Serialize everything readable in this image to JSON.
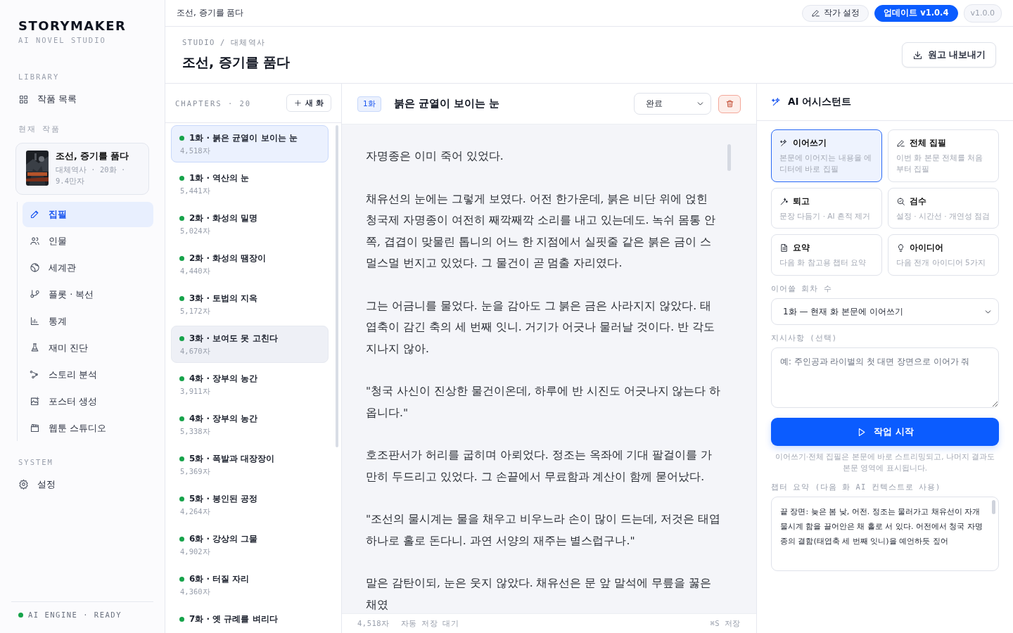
{
  "brand": {
    "name": "STORYMAKER",
    "tagline": "AI NOVEL STUDIO"
  },
  "sidebar": {
    "library_label": "LIBRARY",
    "library_item": {
      "label": "작품 목록"
    },
    "current_label": "현재 작품",
    "current_work": {
      "title": "조선, 증기를 품다",
      "meta": "대체역사 · 20화 · 9.4만자"
    },
    "items": [
      {
        "label": "집필",
        "selected": true
      },
      {
        "label": "인물",
        "selected": false
      },
      {
        "label": "세계관",
        "selected": false
      },
      {
        "label": "플롯 · 복선",
        "selected": false
      },
      {
        "label": "통계",
        "selected": false
      },
      {
        "label": "재미 진단",
        "selected": false
      },
      {
        "label": "스토리 분석",
        "selected": false
      },
      {
        "label": "포스터 생성",
        "selected": false
      },
      {
        "label": "웹툰 스튜디오",
        "selected": false
      }
    ],
    "system_label": "SYSTEM",
    "system_item": {
      "label": "설정"
    },
    "engine_status": {
      "text": "AI ENGINE · READY",
      "color": "#16a34a"
    }
  },
  "topbar": {
    "title": "조선, 증기를 품다",
    "author_button": "작가 설정",
    "update_button": "업데이트 v1.0.4",
    "version": "v1.0.0"
  },
  "header": {
    "breadcrumb": [
      "STUDIO",
      "/",
      "대체역사"
    ],
    "title": "조선, 증기를 품다",
    "export_button": "원고 내보내기"
  },
  "chapters": {
    "label": "CHAPTERS · 20",
    "new_button": "새 화",
    "items": [
      {
        "title": "1화 · 붉은 균열이 보이는 눈",
        "count": "4,518자",
        "selected": true,
        "hovered": false,
        "color": "#16a34a"
      },
      {
        "title": "1화 · 역산의 눈",
        "count": "5,441자",
        "selected": false,
        "hovered": false,
        "color": "#16a34a"
      },
      {
        "title": "2화 · 화성의 밀명",
        "count": "5,024자",
        "selected": false,
        "hovered": false,
        "color": "#16a34a"
      },
      {
        "title": "2화 · 화성의 땜장이",
        "count": "4,440자",
        "selected": false,
        "hovered": false,
        "color": "#16a34a"
      },
      {
        "title": "3화 · 토법의 지옥",
        "count": "5,172자",
        "selected": false,
        "hovered": false,
        "color": "#16a34a"
      },
      {
        "title": "3화 · 보여도 못 고친다",
        "count": "4,670자",
        "selected": false,
        "hovered": true,
        "color": "#16a34a"
      },
      {
        "title": "4화 · 장부의 농간",
        "count": "3,911자",
        "selected": false,
        "hovered": false,
        "color": "#16a34a"
      },
      {
        "title": "4화 · 장부의 농간",
        "count": "5,338자",
        "selected": false,
        "hovered": false,
        "color": "#16a34a"
      },
      {
        "title": "5화 · 폭발과 대장장이",
        "count": "5,369자",
        "selected": false,
        "hovered": false,
        "color": "#16a34a"
      },
      {
        "title": "5화 · 봉인된 공정",
        "count": "4,264자",
        "selected": false,
        "hovered": false,
        "color": "#16a34a"
      },
      {
        "title": "6화 · 강상의 그물",
        "count": "4,902자",
        "selected": false,
        "hovered": false,
        "color": "#16a34a"
      },
      {
        "title": "6화 · 터질 자리",
        "count": "4,360자",
        "selected": false,
        "hovered": false,
        "color": "#16a34a"
      },
      {
        "title": "7화 · 옛 규례를 벼리다",
        "selected": false,
        "hovered": false,
        "color": "#16a34a"
      }
    ]
  },
  "editor": {
    "badge": "1화",
    "title": "붉은 균열이 보이는 눈",
    "status": "완료",
    "paragraphs": [
      "자명종은 이미 죽어 있었다.",
      "채유선의 눈에는 그렇게 보였다. 어전 한가운데, 붉은 비단 위에 얹힌 청국제 자명종이 여전히 째깍째깍 소리를 내고 있는데도. 녹쉬 몸통 안쪽, 겹겹이 맞물린 톱니의 어느 한 지점에서 실핏줄 같은 붉은 금이 스멀스멀 번지고 있었다. 그 물건이 곧 멈출 자리였다.",
      "그는 어금니를 물었다. 눈을 감아도 그 붉은 금은 사라지지 않았다. 태엽축이 감긴 축의 세 번째 잇니. 거기가 어긋나 물러날 것이다. 반 각도 지나지 않아.",
      "\"청국 사신이 진상한 물건이온데, 하루에 반 시진도 어긋나지 않는다 하옵니다.\"",
      "호조판서가 허리를 굽히며 아뢰었다. 정조는 옥좌에 기대 팔걸이를 가만히 두드리고 있었다. 그 손끝에서 무료함과 계산이 함께 묻어났다.",
      "\"조선의 물시계는 물을 채우고 비우느라 손이 많이 드는데, 저것은 태엽 하나로 홀로 돈다니. 과연 서양의 재주는 별스럽구나.\"",
      "말은 감탄이되, 눈은 웃지 않았다. 채유선은 문 앞 말석에 무릎을 꿇은 채였"
    ],
    "footer": {
      "count": "4,518자",
      "autosave": "자동 저장 대기",
      "shortcut": "⌘S 저장"
    }
  },
  "assistant": {
    "title": "AI 어시스턴트",
    "actions": [
      {
        "title": "이어쓰기",
        "desc": "본문에 이어지는 내용을 에디터에 바로 집필",
        "selected": true
      },
      {
        "title": "전체 집필",
        "desc": "이번 화 본문 전체를 처음부터 집필",
        "selected": false
      },
      {
        "title": "퇴고",
        "desc": "문장 다듬기 · AI 흔적 제거",
        "selected": false
      },
      {
        "title": "검수",
        "desc": "설정 · 시간선 · 개연성 점검",
        "selected": false
      },
      {
        "title": "요약",
        "desc": "다음 화 참고용 챕터 요약",
        "selected": false
      },
      {
        "title": "아이디어",
        "desc": "다음 전개 아이디어 5가지",
        "selected": false
      }
    ],
    "count_label": "이어쓸 회차 수",
    "count_value": "1화 — 현재 화 본문에 이어쓰기",
    "instruction_label": "지시사항 (선택)",
    "instruction_placeholder": "예: 주인공과 라이벌의 첫 대면 장면으로 이어가 줘",
    "start_button": "작업 시작",
    "note": "이어쓰기·전체 집필은 본문에 바로 스트리밍되고, 나머지 결과도 본문 영역에 표시됩니다.",
    "summary_label": "챕터 요약 (다음 화 AI 컨텍스트로 사용)",
    "summary": "끝 장면: 늦은 봄 낮, 어전. 정조는 물러가고 채유선이 자개 물시계 함을 끌어안은 채 홀로 서 있다. 어전에서 청국 자명종의 결함(태엽축 세 번째 잇니)을 예언하듯 짚어"
  }
}
